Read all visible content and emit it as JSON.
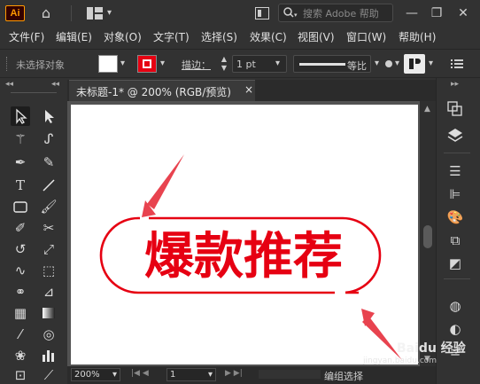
{
  "titlebar": {
    "logo": "Ai",
    "search_placeholder": "搜索 Adobe 帮助",
    "icons": [
      "home-icon",
      "workspace-layout-icon",
      "panel-toggle-icon",
      "search-icon",
      "minimize-icon",
      "restore-icon",
      "close-icon"
    ]
  },
  "menu": [
    "文件(F)",
    "编辑(E)",
    "对象(O)",
    "文字(T)",
    "选择(S)",
    "效果(C)",
    "视图(V)",
    "窗口(W)",
    "帮助(H)"
  ],
  "control": {
    "no_selection": "未选择对象",
    "stroke_label": "描边：",
    "stroke_value": "1 pt",
    "profile_label": "等比",
    "fill_color": "#ffffff",
    "stroke_color": "#e60012"
  },
  "document": {
    "tab_title": "未标题-1* @ 200% (RGB/预览)",
    "close_glyph": "×"
  },
  "artwork": {
    "headline": "爆款推荐",
    "accent_color": "#e60012"
  },
  "status": {
    "zoom": "200%",
    "artboard": "1",
    "tool_hint": "编组选择"
  },
  "watermark": {
    "brand": "Baidu 经验",
    "url": "jingyan.baidu.com"
  }
}
